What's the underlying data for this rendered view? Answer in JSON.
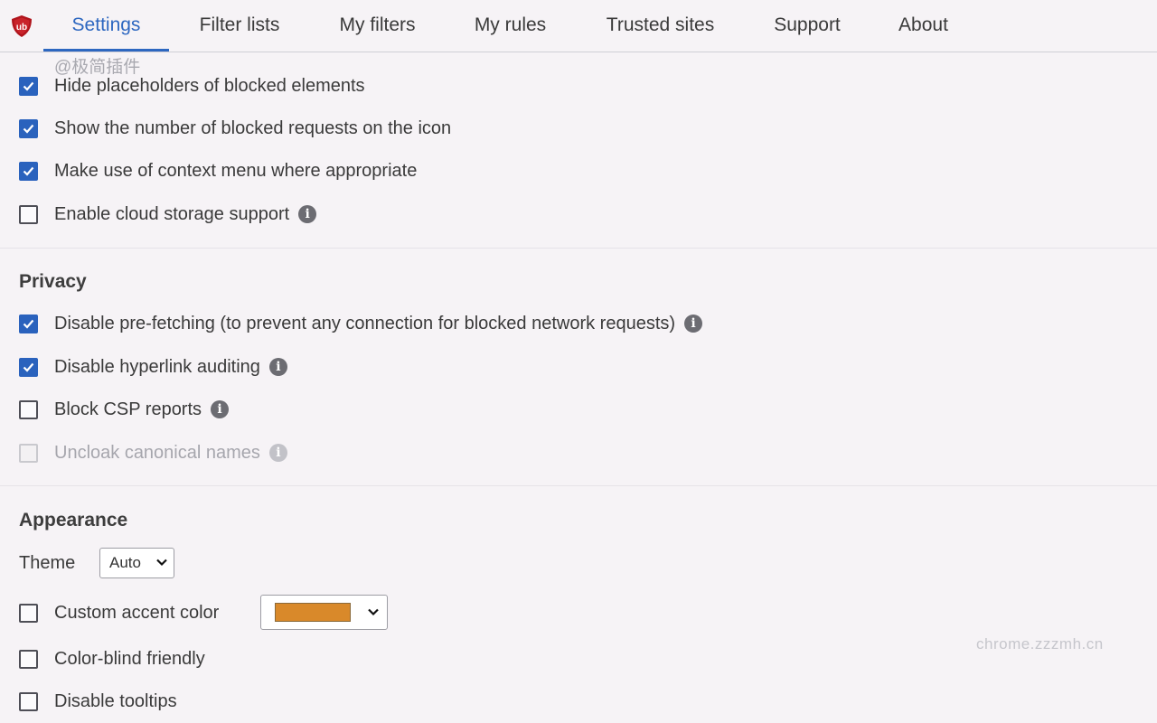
{
  "tabs": [
    {
      "label": "Settings",
      "active": true
    },
    {
      "label": "Filter lists",
      "active": false
    },
    {
      "label": "My filters",
      "active": false
    },
    {
      "label": "My rules",
      "active": false
    },
    {
      "label": "Trusted sites",
      "active": false
    },
    {
      "label": "Support",
      "active": false
    },
    {
      "label": "About",
      "active": false
    }
  ],
  "watermarks": {
    "top": "@极简插件",
    "bottom": "chrome.zzzmh.cn"
  },
  "general": {
    "items": [
      {
        "label": "Hide placeholders of blocked elements",
        "checked": true
      },
      {
        "label": "Show the number of blocked requests on the icon",
        "checked": true
      },
      {
        "label": "Make use of context menu where appropriate",
        "checked": true
      },
      {
        "label": "Enable cloud storage support",
        "checked": false,
        "info": true
      }
    ]
  },
  "privacy": {
    "title": "Privacy",
    "items": [
      {
        "label": "Disable pre-fetching (to prevent any connection for blocked network requests)",
        "checked": true,
        "info": true
      },
      {
        "label": "Disable hyperlink auditing",
        "checked": true,
        "info": true
      },
      {
        "label": "Block CSP reports",
        "checked": false,
        "info": true
      },
      {
        "label": "Uncloak canonical names",
        "checked": false,
        "disabled": true,
        "info": true
      }
    ]
  },
  "appearance": {
    "title": "Appearance",
    "theme_label": "Theme",
    "theme_value": "Auto",
    "accent_label": "Custom accent color",
    "accent_checked": false,
    "accent_color": "#d9892a",
    "colorblind_label": "Color-blind friendly",
    "colorblind_checked": false,
    "tooltips_label": "Disable tooltips",
    "tooltips_checked": false
  },
  "colors": {
    "accent": "#2d67c0",
    "checkbox": "#2a62bd",
    "logo": "#b0141c"
  },
  "icons": {
    "logo": "ublock-shield-icon",
    "info": "info-icon",
    "check": "check-icon",
    "chevron": "chevron-down-icon"
  }
}
